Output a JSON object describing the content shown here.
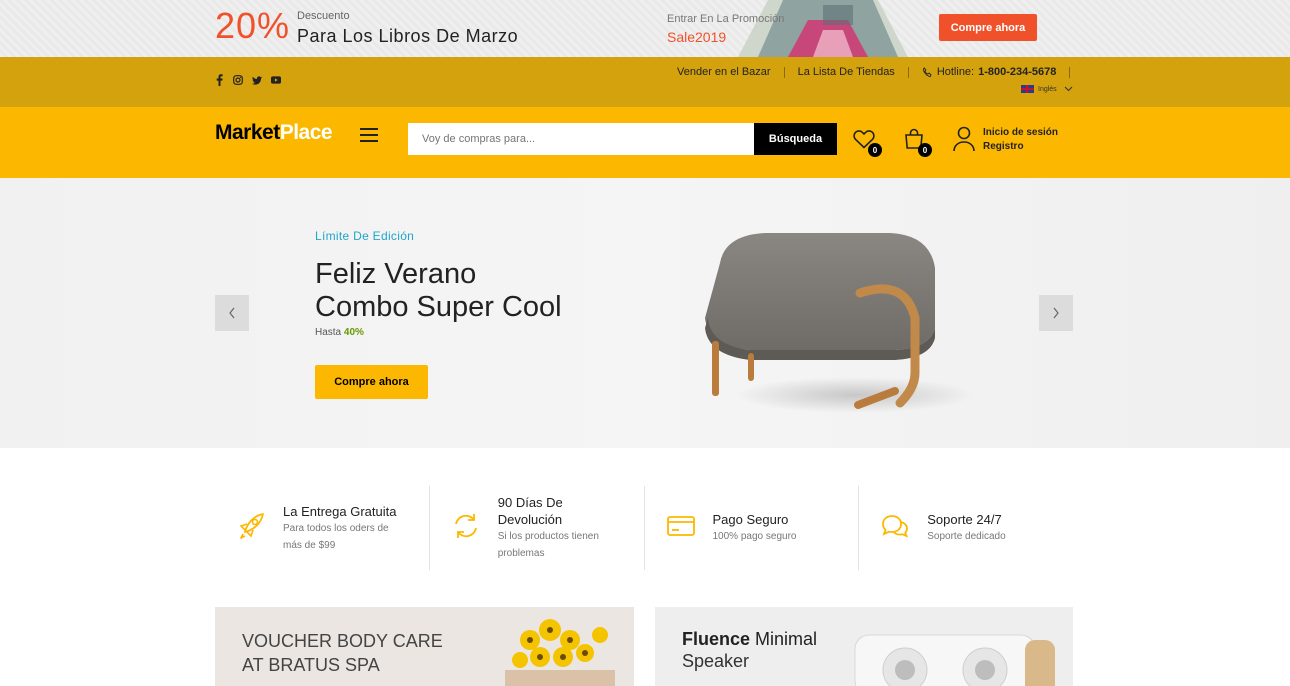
{
  "promo": {
    "percent": "20%",
    "discount_label": "Descuento",
    "title": "Para Los Libros De Marzo",
    "enter_label": "Entrar En La Promoción",
    "code": "Sale2019",
    "button": "Compre ahora"
  },
  "topbar": {
    "social_icons": [
      "facebook-icon",
      "instagram-icon",
      "twitter-icon",
      "youtube-icon"
    ],
    "sell_link": "Vender en el Bazar",
    "stores_link": "La Lista De Tiendas",
    "hotline_label": "Hotline:",
    "hotline_number": "1-800-234-5678",
    "language": "Inglés"
  },
  "header": {
    "logo_part1": "Market",
    "logo_part2": "Place",
    "search_placeholder": "Voy de compras para...",
    "search_button": "Búsqueda",
    "wishlist_count": "0",
    "cart_count": "0",
    "login": "Inicio de sesión",
    "register": "Registro"
  },
  "hero": {
    "eyebrow": "Límite De Edición",
    "title_line1": "Feliz Verano",
    "title_line2": "Combo Super Cool",
    "up_to": "Hasta",
    "discount": "40%",
    "button": "Compre ahora"
  },
  "features": [
    {
      "icon": "rocket-icon",
      "title": "La Entrega Gratuita",
      "desc1": "Para todos los oders de",
      "desc2": "más de $99"
    },
    {
      "icon": "refresh-icon",
      "title1": "90 Días De",
      "title2": "Devolución",
      "desc1": "Si los productos tienen",
      "desc2": "problemas"
    },
    {
      "icon": "credit-card-icon",
      "title": "Pago Seguro",
      "desc1": "100% pago seguro"
    },
    {
      "icon": "chat-icon",
      "title": "Soporte 24/7",
      "desc1": "Soporte dedicado"
    }
  ],
  "banners": {
    "spa_line1": "VOUCHER BODY CARE",
    "spa_line2": "AT BRATUS SPA",
    "speaker_brand": "Fluence",
    "speaker_word": "Minimal",
    "speaker_line2": "Speaker"
  },
  "colors": {
    "accent": "#fcb800",
    "promo_orange": "#f0512a",
    "topbar": "#d4a20c",
    "eyebrow_blue": "#1fa6c9",
    "discount_green": "#669900"
  }
}
